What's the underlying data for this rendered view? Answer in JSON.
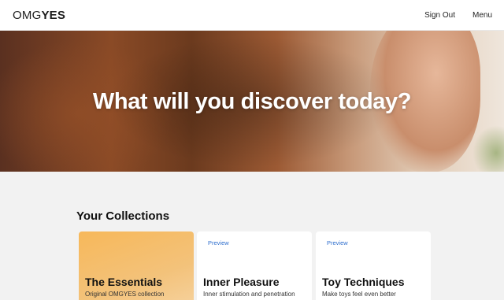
{
  "header": {
    "logo_light": "OMG",
    "logo_bold": "YES",
    "nav": [
      "Sign Out",
      "Menu"
    ]
  },
  "hero": {
    "heading": "What will you discover today?"
  },
  "collections": {
    "title": "Your Collections",
    "cards": [
      {
        "badge": "",
        "title": "The Essentials",
        "subtitle": "Original OMGYES collection"
      },
      {
        "badge": "Preview",
        "title": "Inner Pleasure",
        "subtitle": "Inner stimulation and penetration"
      },
      {
        "badge": "Preview",
        "title": "Toy Techniques",
        "subtitle": "Make toys feel even better"
      }
    ]
  },
  "colors": {
    "link_blue": "#2f6fce",
    "essentials_card": "#f7b85a",
    "page_background": "#f2f2f2"
  }
}
